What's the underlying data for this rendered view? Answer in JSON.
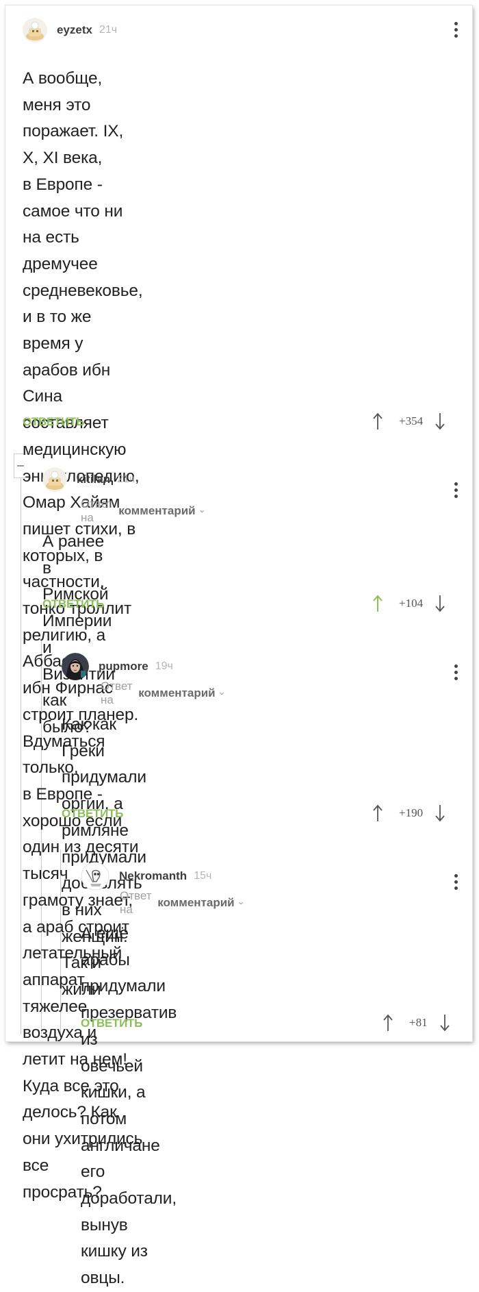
{
  "comments": [
    {
      "nick": "eyzetx",
      "time": "21ч",
      "text": "А вообще, меня это поражает. IX, X, XI века,\nв Европе - самое что ни на есть дремучее\nсредневековье,  и в то же время у арабов ибн\nСина составляет медицинскую энциклопедию,\nОмар Хайям пишет стихи, в которых, в\nчастности, тонко троллит религию, а Аббас\nибн Фирнас строит планер. Вдуматься только,\nв Европе - хорошо если один из десяти тысяч\nграмоту знает, а араб строит летательный\nаппарат тяжелее воздуха и летит на нем!\nКуда все это делось? Как они ухитрились все\nпросрать?",
      "reply_label": "ОТВЕТИТЬ",
      "rating": "+354"
    },
    {
      "nick": "kitilan",
      "time": "21ч",
      "reply_prefix": "Ответ на",
      "reply_target": "комментарий",
      "text": "А ранее в Римской Империи и Византии как\nбыло?",
      "reply_label": "ОТВЕТИТЬ",
      "rating": "+104",
      "upvoted": true
    },
    {
      "nick": "pupmore",
      "time": "19ч",
      "reply_prefix": "Ответ на",
      "reply_target": "комментарий",
      "text": "Как как Греки придумали оргии, а римляне\nпридумали добавлять в них женщин. Так и\nжили",
      "reply_label": "ОТВЕТИТЬ",
      "rating": "+190"
    },
    {
      "nick": "Nekromanth",
      "time": "15ч",
      "reply_prefix": "Ответ на",
      "reply_target": "комментарий",
      "text": "А ещё арабы придумали презерватив из\nовечьей кишки, а потом англичане его\nдоработали, вынув кишку из овцы.",
      "reply_label": "ОТВЕТИТЬ",
      "rating": "+81"
    }
  ],
  "colors": {
    "accent_green": "#8cbf5a",
    "text": "#222222",
    "muted": "#a0a0a0"
  },
  "icons": [
    "default-avatar-icon",
    "more-options-icon",
    "upvote-arrow-icon",
    "downvote-arrow-icon",
    "chevron-down-icon",
    "collapse-branch-icon"
  ]
}
